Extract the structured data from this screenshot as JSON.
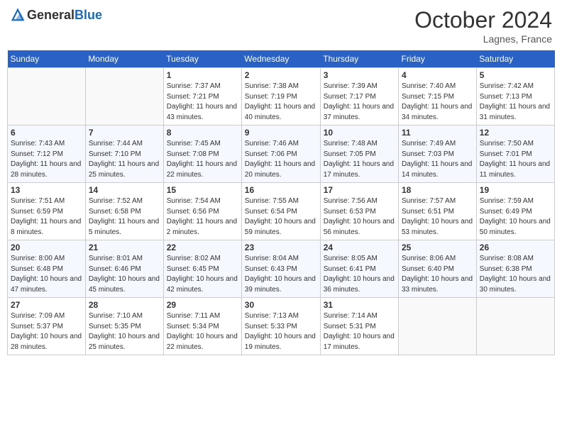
{
  "header": {
    "logo_general": "General",
    "logo_blue": "Blue",
    "month": "October 2024",
    "location": "Lagnes, France"
  },
  "days_of_week": [
    "Sunday",
    "Monday",
    "Tuesday",
    "Wednesday",
    "Thursday",
    "Friday",
    "Saturday"
  ],
  "weeks": [
    [
      {
        "day": "",
        "info": ""
      },
      {
        "day": "",
        "info": ""
      },
      {
        "day": "1",
        "info": "Sunrise: 7:37 AM\nSunset: 7:21 PM\nDaylight: 11 hours and 43 minutes."
      },
      {
        "day": "2",
        "info": "Sunrise: 7:38 AM\nSunset: 7:19 PM\nDaylight: 11 hours and 40 minutes."
      },
      {
        "day": "3",
        "info": "Sunrise: 7:39 AM\nSunset: 7:17 PM\nDaylight: 11 hours and 37 minutes."
      },
      {
        "day": "4",
        "info": "Sunrise: 7:40 AM\nSunset: 7:15 PM\nDaylight: 11 hours and 34 minutes."
      },
      {
        "day": "5",
        "info": "Sunrise: 7:42 AM\nSunset: 7:13 PM\nDaylight: 11 hours and 31 minutes."
      }
    ],
    [
      {
        "day": "6",
        "info": "Sunrise: 7:43 AM\nSunset: 7:12 PM\nDaylight: 11 hours and 28 minutes."
      },
      {
        "day": "7",
        "info": "Sunrise: 7:44 AM\nSunset: 7:10 PM\nDaylight: 11 hours and 25 minutes."
      },
      {
        "day": "8",
        "info": "Sunrise: 7:45 AM\nSunset: 7:08 PM\nDaylight: 11 hours and 22 minutes."
      },
      {
        "day": "9",
        "info": "Sunrise: 7:46 AM\nSunset: 7:06 PM\nDaylight: 11 hours and 20 minutes."
      },
      {
        "day": "10",
        "info": "Sunrise: 7:48 AM\nSunset: 7:05 PM\nDaylight: 11 hours and 17 minutes."
      },
      {
        "day": "11",
        "info": "Sunrise: 7:49 AM\nSunset: 7:03 PM\nDaylight: 11 hours and 14 minutes."
      },
      {
        "day": "12",
        "info": "Sunrise: 7:50 AM\nSunset: 7:01 PM\nDaylight: 11 hours and 11 minutes."
      }
    ],
    [
      {
        "day": "13",
        "info": "Sunrise: 7:51 AM\nSunset: 6:59 PM\nDaylight: 11 hours and 8 minutes."
      },
      {
        "day": "14",
        "info": "Sunrise: 7:52 AM\nSunset: 6:58 PM\nDaylight: 11 hours and 5 minutes."
      },
      {
        "day": "15",
        "info": "Sunrise: 7:54 AM\nSunset: 6:56 PM\nDaylight: 11 hours and 2 minutes."
      },
      {
        "day": "16",
        "info": "Sunrise: 7:55 AM\nSunset: 6:54 PM\nDaylight: 10 hours and 59 minutes."
      },
      {
        "day": "17",
        "info": "Sunrise: 7:56 AM\nSunset: 6:53 PM\nDaylight: 10 hours and 56 minutes."
      },
      {
        "day": "18",
        "info": "Sunrise: 7:57 AM\nSunset: 6:51 PM\nDaylight: 10 hours and 53 minutes."
      },
      {
        "day": "19",
        "info": "Sunrise: 7:59 AM\nSunset: 6:49 PM\nDaylight: 10 hours and 50 minutes."
      }
    ],
    [
      {
        "day": "20",
        "info": "Sunrise: 8:00 AM\nSunset: 6:48 PM\nDaylight: 10 hours and 47 minutes."
      },
      {
        "day": "21",
        "info": "Sunrise: 8:01 AM\nSunset: 6:46 PM\nDaylight: 10 hours and 45 minutes."
      },
      {
        "day": "22",
        "info": "Sunrise: 8:02 AM\nSunset: 6:45 PM\nDaylight: 10 hours and 42 minutes."
      },
      {
        "day": "23",
        "info": "Sunrise: 8:04 AM\nSunset: 6:43 PM\nDaylight: 10 hours and 39 minutes."
      },
      {
        "day": "24",
        "info": "Sunrise: 8:05 AM\nSunset: 6:41 PM\nDaylight: 10 hours and 36 minutes."
      },
      {
        "day": "25",
        "info": "Sunrise: 8:06 AM\nSunset: 6:40 PM\nDaylight: 10 hours and 33 minutes."
      },
      {
        "day": "26",
        "info": "Sunrise: 8:08 AM\nSunset: 6:38 PM\nDaylight: 10 hours and 30 minutes."
      }
    ],
    [
      {
        "day": "27",
        "info": "Sunrise: 7:09 AM\nSunset: 5:37 PM\nDaylight: 10 hours and 28 minutes."
      },
      {
        "day": "28",
        "info": "Sunrise: 7:10 AM\nSunset: 5:35 PM\nDaylight: 10 hours and 25 minutes."
      },
      {
        "day": "29",
        "info": "Sunrise: 7:11 AM\nSunset: 5:34 PM\nDaylight: 10 hours and 22 minutes."
      },
      {
        "day": "30",
        "info": "Sunrise: 7:13 AM\nSunset: 5:33 PM\nDaylight: 10 hours and 19 minutes."
      },
      {
        "day": "31",
        "info": "Sunrise: 7:14 AM\nSunset: 5:31 PM\nDaylight: 10 hours and 17 minutes."
      },
      {
        "day": "",
        "info": ""
      },
      {
        "day": "",
        "info": ""
      }
    ]
  ]
}
